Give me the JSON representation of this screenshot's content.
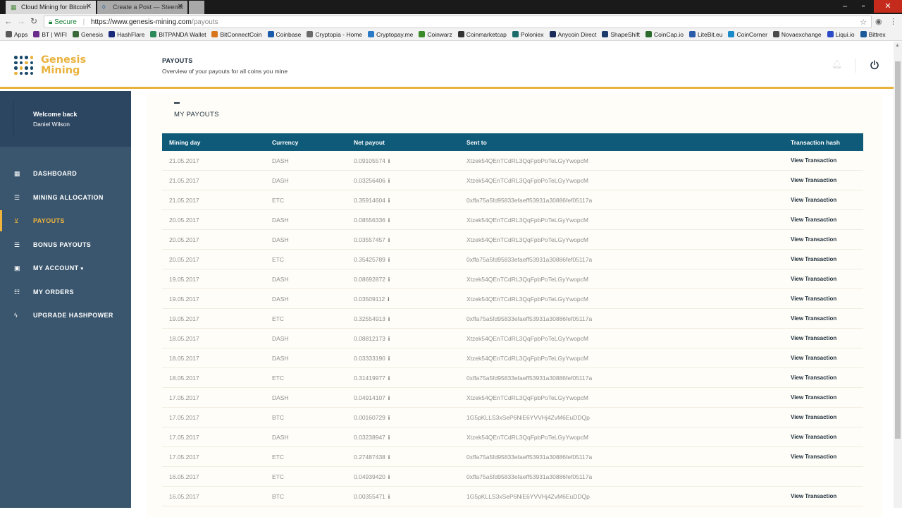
{
  "browser": {
    "tabs": [
      {
        "title": "Cloud Mining for Bitcoin",
        "active": true
      },
      {
        "title": "Create a Post — Steemit",
        "active": false
      }
    ],
    "secure_label": "Secure",
    "url_main": "https://www.genesis-mining.com",
    "url_path": "/payouts",
    "bookmarks": [
      {
        "label": "Apps",
        "color": "#5a5a5a"
      },
      {
        "label": "BT | WIFI",
        "color": "#6a2c8a"
      },
      {
        "label": "Genesis",
        "color": "#3a6a3a"
      },
      {
        "label": "HashFlare",
        "color": "#1a2a7a"
      },
      {
        "label": "BITPANDA Wallet",
        "color": "#2c8a5a"
      },
      {
        "label": "BitConnectCoin",
        "color": "#d8741c"
      },
      {
        "label": "Coinbase",
        "color": "#1a5aaa"
      },
      {
        "label": "Cryptopia - Home",
        "color": "#6a6a6a"
      },
      {
        "label": "Cryptopay.me",
        "color": "#2a7ac8"
      },
      {
        "label": "Coinwarz",
        "color": "#3a8a2a"
      },
      {
        "label": "Coinmarketcap",
        "color": "#333333"
      },
      {
        "label": "Poloniex",
        "color": "#1a6a6a"
      },
      {
        "label": "Anycoin Direct",
        "color": "#1a2a5a"
      },
      {
        "label": "ShapeShift",
        "color": "#1a3a6a"
      },
      {
        "label": "CoinCap.io",
        "color": "#2a6a2a"
      },
      {
        "label": "LiteBit.eu",
        "color": "#2a5aaa"
      },
      {
        "label": "CoinCorner",
        "color": "#1a8ac8"
      },
      {
        "label": "Novaexchange",
        "color": "#4a4a4a"
      },
      {
        "label": "Liqui.io",
        "color": "#2a4ac8"
      },
      {
        "label": "Bittrex",
        "color": "#1a5a9a"
      }
    ]
  },
  "header": {
    "logo_line1": "Genesis",
    "logo_line2": "Mining",
    "page_title": "PAYOUTS",
    "page_subtitle": "Overview of your payouts for all coins you mine"
  },
  "sidebar": {
    "welcome": "Welcome back",
    "user_name": "Daniel Wilson",
    "items": [
      {
        "label": "DASHBOARD",
        "icon": "dashboard-icon",
        "glyph": "▦",
        "active": false
      },
      {
        "label": "MINING ALLOCATION",
        "icon": "sliders-icon",
        "glyph": "☰",
        "active": false
      },
      {
        "label": "PAYOUTS",
        "icon": "payouts-icon",
        "glyph": "⊻",
        "active": true
      },
      {
        "label": "BONUS PAYOUTS",
        "icon": "list-icon",
        "glyph": "☰",
        "active": false
      },
      {
        "label": "MY ACCOUNT",
        "icon": "account-icon",
        "glyph": "▣",
        "active": false,
        "caret": "▾"
      },
      {
        "label": "MY ORDERS",
        "icon": "orders-icon",
        "glyph": "☷",
        "active": false
      },
      {
        "label": "UPGRADE HASHPOWER",
        "icon": "bolt-icon",
        "glyph": "ϟ",
        "active": false
      }
    ]
  },
  "main": {
    "section_title": "MY PAYOUTS",
    "columns": [
      "Mining day",
      "Currency",
      "Net payout",
      "Sent to",
      "Transaction hash"
    ],
    "rows": [
      {
        "day": "21.05.2017",
        "currency": "DASH",
        "net": "0.09105574",
        "sent": "Xtzek54QEnTCdRL3QqFpbPoTeLGyYwopcM",
        "hash": "View Transaction"
      },
      {
        "day": "21.05.2017",
        "currency": "DASH",
        "net": "0.03256406",
        "sent": "Xtzek54QEnTCdRL3QqFpbPoTeLGyYwopcM",
        "hash": "View Transaction"
      },
      {
        "day": "21.05.2017",
        "currency": "ETC",
        "net": "0.35914604",
        "sent": "0xffa75a5fd95833efaeff53931a30886fef05117a",
        "hash": "View Transaction"
      },
      {
        "day": "20.05.2017",
        "currency": "DASH",
        "net": "0.08556336",
        "sent": "Xtzek54QEnTCdRL3QqFpbPoTeLGyYwopcM",
        "hash": "View Transaction"
      },
      {
        "day": "20.05.2017",
        "currency": "DASH",
        "net": "0.03557457",
        "sent": "Xtzek54QEnTCdRL3QqFpbPoTeLGyYwopcM",
        "hash": "View Transaction"
      },
      {
        "day": "20.05.2017",
        "currency": "ETC",
        "net": "0.35425789",
        "sent": "0xffa75a5fd95833efaeff53931a30886fef05117a",
        "hash": "View Transaction"
      },
      {
        "day": "19.05.2017",
        "currency": "DASH",
        "net": "0.08692872",
        "sent": "Xtzek54QEnTCdRL3QqFpbPoTeLGyYwopcM",
        "hash": "View Transaction"
      },
      {
        "day": "19.05.2017",
        "currency": "DASH",
        "net": "0.03509112",
        "sent": "Xtzek54QEnTCdRL3QqFpbPoTeLGyYwopcM",
        "hash": "View Transaction"
      },
      {
        "day": "19.05.2017",
        "currency": "ETC",
        "net": "0.32554913",
        "sent": "0xffa75a5fd95833efaeff53931a30886fef05117a",
        "hash": "View Transaction"
      },
      {
        "day": "18.05.2017",
        "currency": "DASH",
        "net": "0.08812173",
        "sent": "Xtzek54QEnTCdRL3QqFpbPoTeLGyYwopcM",
        "hash": "View Transaction"
      },
      {
        "day": "18.05.2017",
        "currency": "DASH",
        "net": "0.03333190",
        "sent": "Xtzek54QEnTCdRL3QqFpbPoTeLGyYwopcM",
        "hash": "View Transaction"
      },
      {
        "day": "18.05.2017",
        "currency": "ETC",
        "net": "0.31419977",
        "sent": "0xffa75a5fd95833efaeff53931a30886fef05117a",
        "hash": "View Transaction"
      },
      {
        "day": "17.05.2017",
        "currency": "DASH",
        "net": "0.04914107",
        "sent": "Xtzek54QEnTCdRL3QqFpbPoTeLGyYwopcM",
        "hash": "View Transaction"
      },
      {
        "day": "17.05.2017",
        "currency": "BTC",
        "net": "0.00160729",
        "sent": "1G5pKLLS3xSeP6NiE6YVVHj4ZvM6EuDDQp",
        "hash": "View Transaction"
      },
      {
        "day": "17.05.2017",
        "currency": "DASH",
        "net": "0.03238947",
        "sent": "Xtzek54QEnTCdRL3QqFpbPoTeLGyYwopcM",
        "hash": "View Transaction"
      },
      {
        "day": "17.05.2017",
        "currency": "ETC",
        "net": "0.27487438",
        "sent": "0xffa75a5fd95833efaeff53931a30886fef05117a",
        "hash": "View Transaction"
      },
      {
        "day": "16.05.2017",
        "currency": "ETC",
        "net": "0.04939420",
        "sent": "0xffa75a5fd95833efaeff53931a30886fef05117a",
        "hash": ""
      },
      {
        "day": "16.05.2017",
        "currency": "BTC",
        "net": "0.00355471",
        "sent": "1G5pKLLS3xSeP6NiE6YVVHj4ZvM6EuDDQp",
        "hash": "View Transaction"
      }
    ],
    "info_glyph": "i"
  },
  "colors": {
    "accent": "#e8b23d",
    "sidebar": "#3a566e",
    "table_header": "#0f5a78"
  }
}
